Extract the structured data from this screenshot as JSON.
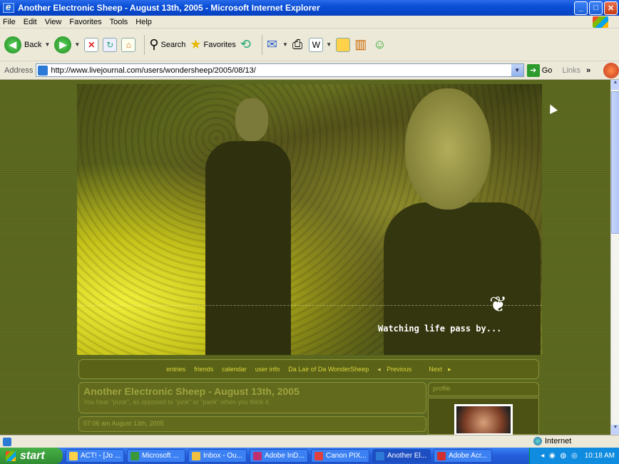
{
  "window": {
    "title": "Another Electronic Sheep - August 13th, 2005 - Microsoft Internet Explorer",
    "min_glyph": "_",
    "max_glyph": "□",
    "close_glyph": "✕"
  },
  "menu": {
    "items": [
      "File",
      "Edit",
      "View",
      "Favorites",
      "Tools",
      "Help"
    ]
  },
  "toolbar": {
    "back_label": "Back",
    "search_label": "Search",
    "favorites_label": "Favorites"
  },
  "address": {
    "label": "Address",
    "url": "http://www.livejournal.com/users/wondersheep/2005/08/13/",
    "go_label": "Go",
    "links_label": "Links"
  },
  "page": {
    "banner_tagline": "Watching life pass by...",
    "nav": [
      "entries",
      "friends",
      "calendar",
      "user info",
      "Da Lair of Da WonderSheep",
      "Previous",
      "Next"
    ],
    "post_title": "Another Electronic Sheep - August 13th, 2005",
    "post_subtitle": "You hear \"punk\", as opposed to \"pink\" or \"pank\" when you think it.",
    "post_time": "07:06 am August 13th, 2005",
    "profile_label": "profile"
  },
  "status": {
    "zone": "Internet"
  },
  "taskbar": {
    "start_label": "start",
    "tasks": [
      "ACT! - [Jo ...",
      "Microsoft ...",
      "Inbox - Ou...",
      "Adobe InD...",
      "Canon PIX...",
      "Another El...",
      "Adobe Acr..."
    ],
    "active_task_index": 5,
    "clock": "10:18 AM"
  }
}
